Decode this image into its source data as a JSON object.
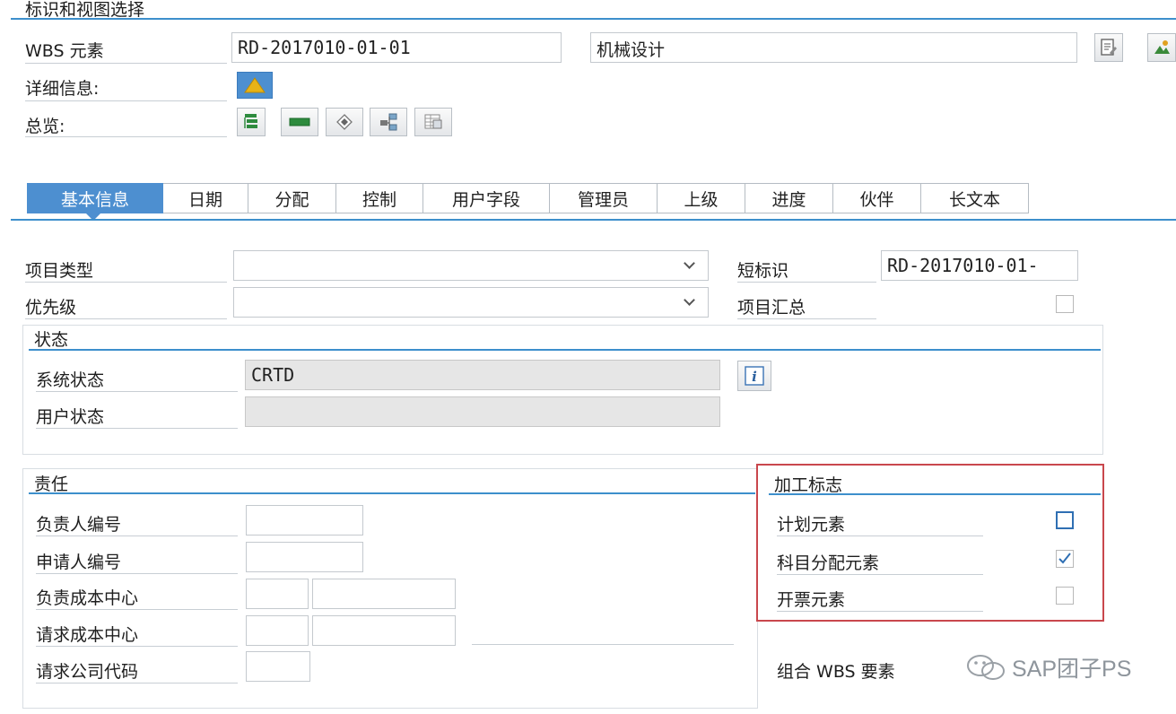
{
  "header": {
    "section_title": "标识和视图选择",
    "wbs_label": "WBS 元素",
    "wbs_value": "RD-2017010-01-01",
    "wbs_desc": "机械设计",
    "detail_label": "详细信息:",
    "overview_label": "总览:"
  },
  "tabs": [
    {
      "label": "基本信息"
    },
    {
      "label": "日期"
    },
    {
      "label": "分配"
    },
    {
      "label": "控制"
    },
    {
      "label": "用户字段"
    },
    {
      "label": "管理员"
    },
    {
      "label": "上级"
    },
    {
      "label": "进度"
    },
    {
      "label": "伙伴"
    },
    {
      "label": "长文本"
    }
  ],
  "basic": {
    "project_type_label": "项目类型",
    "project_type_value": "",
    "priority_label": "优先级",
    "priority_value": "",
    "short_id_label": "短标识",
    "short_id_value": "RD-2017010-01-",
    "project_summary_label": "项目汇总"
  },
  "status": {
    "title": "状态",
    "system_label": "系统状态",
    "system_value": "CRTD",
    "user_label": "用户状态",
    "user_value": ""
  },
  "responsibility": {
    "title": "责任",
    "responsible_person_label": "负责人编号",
    "applicant_label": "申请人编号",
    "resp_cost_center_label": "负责成本中心",
    "req_cost_center_label": "请求成本中心",
    "req_company_code_label": "请求公司代码"
  },
  "operative": {
    "title": "加工标志",
    "planning_label": "计划元素",
    "planning_checked": false,
    "account_label": "科目分配元素",
    "account_checked": true,
    "billing_label": "开票元素",
    "billing_checked": false,
    "grouping_label": "组合 WBS 要素"
  },
  "watermark": "SAP团子PS",
  "colors": {
    "accent": "#3d8fcc",
    "active_tab": "#4d8fd0",
    "highlight_border": "#c9474d"
  }
}
